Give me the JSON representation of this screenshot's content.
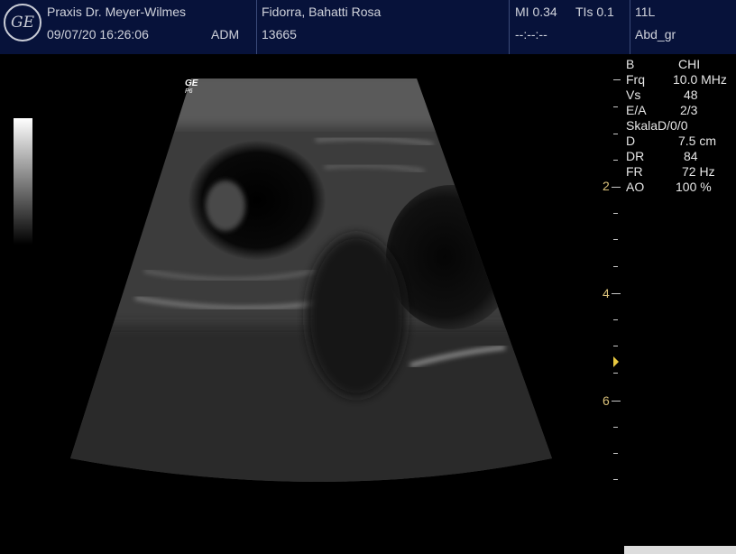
{
  "header": {
    "logo": "GE",
    "clinic": "Praxis Dr. Meyer-Wilmes",
    "datetime": "09/07/20 16:26:06",
    "operator": "ADM",
    "patient_name": "Fidorra, Bahatti Rosa",
    "patient_id": "13665",
    "mi": "MI 0.34",
    "tis": "TIs 0.1",
    "time_placeholder": "--:--:--",
    "probe": "11L",
    "preset": "Abd_gr"
  },
  "image_overlay": {
    "vendor_mark": "GE",
    "vendor_sub": "P6"
  },
  "params": [
    {
      "label": "B",
      "value": "CHI"
    },
    {
      "label": "Frq",
      "value": "10.0 MHz"
    },
    {
      "label": "Vs",
      "value": "48"
    },
    {
      "label": "E/A",
      "value": "2/3"
    },
    {
      "label": "SkalaD/0/0",
      "value": ""
    },
    {
      "label": "D",
      "value": "7.5 cm"
    },
    {
      "label": "DR",
      "value": "84"
    },
    {
      "label": "FR",
      "value": "72 Hz"
    },
    {
      "label": "AO",
      "value": "100 %"
    }
  ],
  "depth_scale": {
    "labels": [
      "2",
      "4",
      "6"
    ]
  },
  "colors": {
    "header_bg": "#07123a",
    "depth_label": "#d9c07a",
    "focus_marker": "#e8c840"
  }
}
